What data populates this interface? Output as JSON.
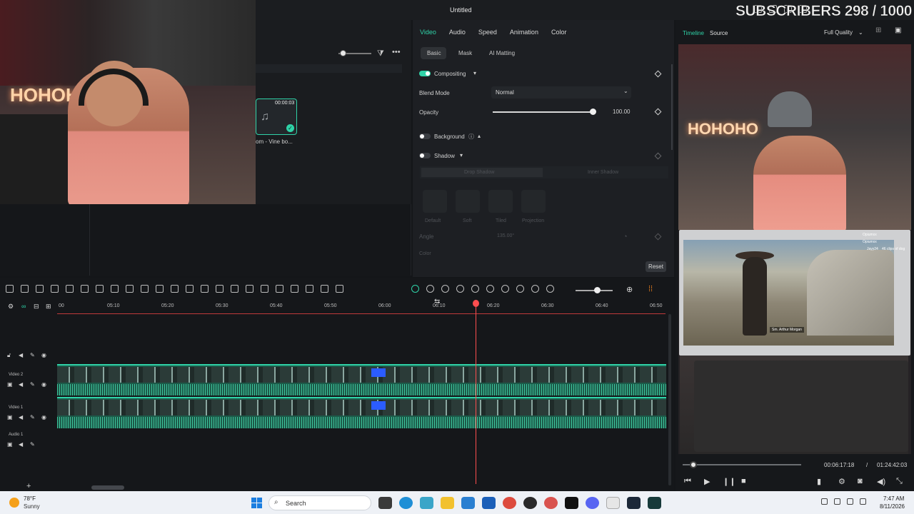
{
  "window": {
    "title": "Untitled"
  },
  "overlay": {
    "subscribers": "SUBSCRIBERS 298 / 1000"
  },
  "media": {
    "clip_duration": "00:00:03",
    "clip_name": "om - Vine bo..."
  },
  "props": {
    "tabs": [
      "Video",
      "Audio",
      "Speed",
      "Animation",
      "Color"
    ],
    "subtabs": [
      "Basic",
      "Mask",
      "AI Matting"
    ],
    "compositing": "Compositing",
    "blend_mode_label": "Blend Mode",
    "blend_mode_value": "Normal",
    "opacity_label": "Opacity",
    "opacity_value": "100.00",
    "opacity_fraction": 1.0,
    "background": "Background",
    "shadow": "Shadow",
    "shadow_tabs": [
      "Drop Shadow",
      "Inner Shadow"
    ],
    "presets": [
      "Default",
      "Soft",
      "Tiled",
      "Projection"
    ],
    "angle_label": "Angle",
    "angle_value": "135.00°",
    "color_label": "Color",
    "reset": "Reset"
  },
  "preview": {
    "tabs": [
      "Timeline",
      "Source"
    ],
    "quality": "Full Quality",
    "current_time": "00:06:17:18",
    "separator": "/",
    "total_time": "01:24:42:03",
    "game_subtitle": "Sm. Arthur Morgan",
    "chat": [
      {
        "user": "Opiumxx",
        "text": ""
      },
      {
        "user": "Opiumxx",
        "text": ""
      },
      {
        "user": "Jayy24",
        "text": "46 clips of dog"
      }
    ]
  },
  "timeline": {
    "ruler": [
      "00",
      "05:10",
      "05:20",
      "05:30",
      "05:40",
      "05:50",
      "06:00",
      "06:10",
      "06:20",
      "06:30",
      "06:40",
      "06:50"
    ],
    "tracks": [
      {
        "name": "Video 2"
      },
      {
        "name": "Video 1"
      },
      {
        "name": "Audio 1"
      }
    ]
  },
  "taskbar": {
    "temp": "78°F",
    "weather": "Sunny",
    "search": "Search",
    "time": "7:47 AM",
    "date": "8/11/2026"
  },
  "colors": {
    "accent": "#2fd3a8",
    "playhead": "#ff4d4f",
    "track": "#1c5a49"
  }
}
